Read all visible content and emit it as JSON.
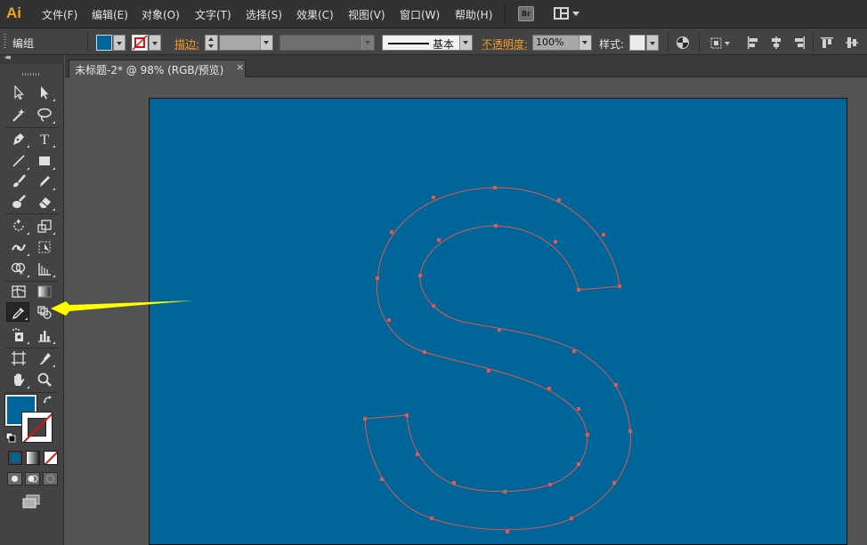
{
  "app": {
    "logo": "Ai"
  },
  "menu": {
    "items": [
      "文件(F)",
      "编辑(E)",
      "对象(O)",
      "文字(T)",
      "选择(S)",
      "效果(C)",
      "视图(V)",
      "窗口(W)",
      "帮助(H)"
    ],
    "bridge_label": "Br"
  },
  "control_bar": {
    "selection_label": "编组",
    "fill_color": "#006699",
    "stroke_label": "描边:",
    "stroke_profile": "基本",
    "opacity_label": "不透明度:",
    "opacity_value": "100%",
    "style_label": "样式:"
  },
  "document": {
    "tab_title": "未标题-2* @ 98% (RGB/预览)",
    "close_label": "×"
  },
  "toolbox": {
    "fill_color": "#006699",
    "stroke_color": "none",
    "active_tool": "eyedropper-tool"
  },
  "artwork": {
    "letter": "S",
    "artboard_color": "#006699",
    "path_color": "#e4574c",
    "annotation_arrow_color": "#ffff00"
  }
}
